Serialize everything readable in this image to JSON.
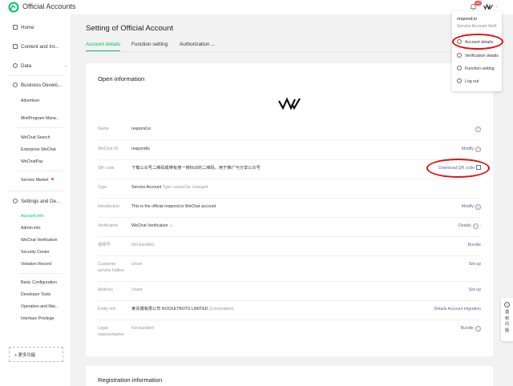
{
  "topbar": {
    "app_title": "Official Accounts",
    "notification_count": "40"
  },
  "sidebar": {
    "home": "Home",
    "content": "Content and Int...",
    "data": "Data",
    "business": "Business Develo...",
    "business_items": [
      "Advertiser",
      "MiniProgram Mana...",
      "WeChat Search",
      "Enterprise WeChat",
      "WeChatPay",
      "Service Market"
    ],
    "settings": "Settings and De...",
    "settings_items": [
      "Account info",
      "Admin info",
      "WeChat Verification",
      "Security Center",
      "Violation Record"
    ],
    "dev_items": [
      "Basic Configuration",
      "Developer Tools",
      "Operation and Mai...",
      "Interface Privilege"
    ],
    "more_functions": "+ 更多功能"
  },
  "main": {
    "title": "Setting of Official Account",
    "tabs": [
      "Account details",
      "Function setting",
      "Authorization ..."
    ]
  },
  "card": {
    "title": "Open information",
    "rows": [
      {
        "label": "Name",
        "value": "respond.io",
        "action": ""
      },
      {
        "label": "WeChat ID",
        "value": "respondio",
        "action": "Modify"
      },
      {
        "label": "QR code",
        "value": "下载公众号二维码或带有搜一搜标识的二维码，用于推广与分享公众号",
        "action": "Download QR code"
      },
      {
        "label": "Type",
        "value": "Service Account",
        "value_extra": "Type cannot be changed",
        "action": ""
      },
      {
        "label": "Introduction",
        "value": "This is the official respond.io WeChat account.",
        "action": "Modify"
      },
      {
        "label": "Verification",
        "value": "WeChat Verification",
        "action": "Details"
      },
      {
        "label": "视频号",
        "value": "Not bundled",
        "action": "Bundle"
      },
      {
        "label": "Customer service hotline",
        "value": "Unset",
        "action": "Set-up"
      },
      {
        "label": "Address",
        "value": "Unset",
        "action": "Set-up"
      },
      {
        "label": "Entity info",
        "value": "東充博有限公司 ROCKETBOTS LIMITED",
        "value_extra": "(Corporation)",
        "action": "Details Account migration"
      },
      {
        "label": "Legal representative",
        "value": "Not bundled",
        "action": "Bundle"
      }
    ]
  },
  "card2": {
    "title": "Registration information"
  },
  "dropdown": {
    "name": "respond.io",
    "subtitle": "Service Account  Verif",
    "items": [
      "Account details",
      "Verification details",
      "Function setting",
      "Log out"
    ]
  },
  "help_widget": {
    "label": "遇到问题"
  },
  "colors": {
    "accent": "#07c160",
    "link": "#576b95",
    "annotation": "#e01010",
    "badge": "#fa5151"
  }
}
